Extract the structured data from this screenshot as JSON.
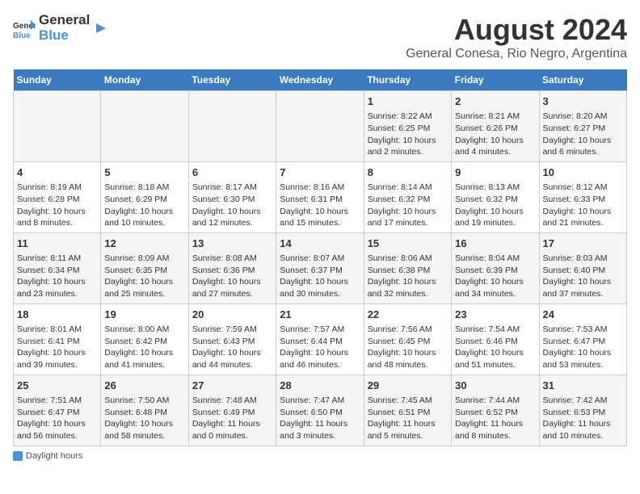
{
  "header": {
    "logo_general": "General",
    "logo_blue": "Blue",
    "title": "August 2024",
    "subtitle": "General Conesa, Rio Negro, Argentina"
  },
  "calendar": {
    "days_of_week": [
      "Sunday",
      "Monday",
      "Tuesday",
      "Wednesday",
      "Thursday",
      "Friday",
      "Saturday"
    ],
    "weeks": [
      [
        {
          "date": "",
          "info": ""
        },
        {
          "date": "",
          "info": ""
        },
        {
          "date": "",
          "info": ""
        },
        {
          "date": "",
          "info": ""
        },
        {
          "date": "1",
          "info": "Sunrise: 8:22 AM\nSunset: 6:25 PM\nDaylight: 10 hours and 2 minutes."
        },
        {
          "date": "2",
          "info": "Sunrise: 8:21 AM\nSunset: 6:26 PM\nDaylight: 10 hours and 4 minutes."
        },
        {
          "date": "3",
          "info": "Sunrise: 8:20 AM\nSunset: 6:27 PM\nDaylight: 10 hours and 6 minutes."
        }
      ],
      [
        {
          "date": "4",
          "info": "Sunrise: 8:19 AM\nSunset: 6:28 PM\nDaylight: 10 hours and 8 minutes."
        },
        {
          "date": "5",
          "info": "Sunrise: 8:18 AM\nSunset: 6:29 PM\nDaylight: 10 hours and 10 minutes."
        },
        {
          "date": "6",
          "info": "Sunrise: 8:17 AM\nSunset: 6:30 PM\nDaylight: 10 hours and 12 minutes."
        },
        {
          "date": "7",
          "info": "Sunrise: 8:16 AM\nSunset: 6:31 PM\nDaylight: 10 hours and 15 minutes."
        },
        {
          "date": "8",
          "info": "Sunrise: 8:14 AM\nSunset: 6:32 PM\nDaylight: 10 hours and 17 minutes."
        },
        {
          "date": "9",
          "info": "Sunrise: 8:13 AM\nSunset: 6:32 PM\nDaylight: 10 hours and 19 minutes."
        },
        {
          "date": "10",
          "info": "Sunrise: 8:12 AM\nSunset: 6:33 PM\nDaylight: 10 hours and 21 minutes."
        }
      ],
      [
        {
          "date": "11",
          "info": "Sunrise: 8:11 AM\nSunset: 6:34 PM\nDaylight: 10 hours and 23 minutes."
        },
        {
          "date": "12",
          "info": "Sunrise: 8:09 AM\nSunset: 6:35 PM\nDaylight: 10 hours and 25 minutes."
        },
        {
          "date": "13",
          "info": "Sunrise: 8:08 AM\nSunset: 6:36 PM\nDaylight: 10 hours and 27 minutes."
        },
        {
          "date": "14",
          "info": "Sunrise: 8:07 AM\nSunset: 6:37 PM\nDaylight: 10 hours and 30 minutes."
        },
        {
          "date": "15",
          "info": "Sunrise: 8:06 AM\nSunset: 6:38 PM\nDaylight: 10 hours and 32 minutes."
        },
        {
          "date": "16",
          "info": "Sunrise: 8:04 AM\nSunset: 6:39 PM\nDaylight: 10 hours and 34 minutes."
        },
        {
          "date": "17",
          "info": "Sunrise: 8:03 AM\nSunset: 6:40 PM\nDaylight: 10 hours and 37 minutes."
        }
      ],
      [
        {
          "date": "18",
          "info": "Sunrise: 8:01 AM\nSunset: 6:41 PM\nDaylight: 10 hours and 39 minutes."
        },
        {
          "date": "19",
          "info": "Sunrise: 8:00 AM\nSunset: 6:42 PM\nDaylight: 10 hours and 41 minutes."
        },
        {
          "date": "20",
          "info": "Sunrise: 7:59 AM\nSunset: 6:43 PM\nDaylight: 10 hours and 44 minutes."
        },
        {
          "date": "21",
          "info": "Sunrise: 7:57 AM\nSunset: 6:44 PM\nDaylight: 10 hours and 46 minutes."
        },
        {
          "date": "22",
          "info": "Sunrise: 7:56 AM\nSunset: 6:45 PM\nDaylight: 10 hours and 48 minutes."
        },
        {
          "date": "23",
          "info": "Sunrise: 7:54 AM\nSunset: 6:46 PM\nDaylight: 10 hours and 51 minutes."
        },
        {
          "date": "24",
          "info": "Sunrise: 7:53 AM\nSunset: 6:47 PM\nDaylight: 10 hours and 53 minutes."
        }
      ],
      [
        {
          "date": "25",
          "info": "Sunrise: 7:51 AM\nSunset: 6:47 PM\nDaylight: 10 hours and 56 minutes."
        },
        {
          "date": "26",
          "info": "Sunrise: 7:50 AM\nSunset: 6:48 PM\nDaylight: 10 hours and 58 minutes."
        },
        {
          "date": "27",
          "info": "Sunrise: 7:48 AM\nSunset: 6:49 PM\nDaylight: 11 hours and 0 minutes."
        },
        {
          "date": "28",
          "info": "Sunrise: 7:47 AM\nSunset: 6:50 PM\nDaylight: 11 hours and 3 minutes."
        },
        {
          "date": "29",
          "info": "Sunrise: 7:45 AM\nSunset: 6:51 PM\nDaylight: 11 hours and 5 minutes."
        },
        {
          "date": "30",
          "info": "Sunrise: 7:44 AM\nSunset: 6:52 PM\nDaylight: 11 hours and 8 minutes."
        },
        {
          "date": "31",
          "info": "Sunrise: 7:42 AM\nSunset: 6:53 PM\nDaylight: 11 hours and 10 minutes."
        }
      ]
    ]
  },
  "legend": {
    "label": "Daylight hours"
  }
}
